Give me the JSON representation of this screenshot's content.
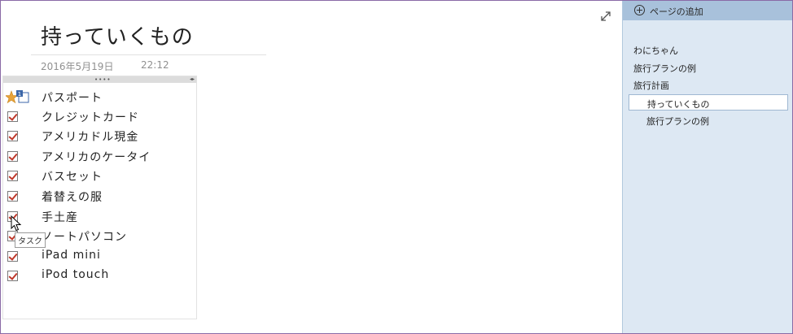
{
  "page": {
    "title": "持っていくもの",
    "date": "2016年5月19日",
    "time": "22:12"
  },
  "note": {
    "items": [
      {
        "label": "パスポート",
        "type": "star-tag"
      },
      {
        "label": "クレジットカード",
        "type": "checked"
      },
      {
        "label": "アメリカドル現金",
        "type": "checked"
      },
      {
        "label": "アメリカのケータイ",
        "type": "checked"
      },
      {
        "label": "バスセット",
        "type": "checked"
      },
      {
        "label": "着替えの服",
        "type": "checked"
      },
      {
        "label": "手土産",
        "type": "checked"
      },
      {
        "label": "ノートパソコン",
        "type": "checked"
      },
      {
        "label": "iPad mini",
        "type": "checked"
      },
      {
        "label": "iPod touch",
        "type": "checked"
      }
    ],
    "tooltip": "タスク"
  },
  "pages_pane": {
    "add_page_label": "ページの追加",
    "pages": [
      {
        "label": "わにちゃん",
        "level": 1
      },
      {
        "label": "旅行プランの例",
        "level": 1
      },
      {
        "label": "旅行計画",
        "level": 1
      },
      {
        "label": "持っていくもの",
        "level": 2,
        "selected": true
      },
      {
        "label": "旅行プランの例",
        "level": 2
      }
    ]
  },
  "colors": {
    "pane_bg": "#dde8f3",
    "add_page_bg": "#a8c1db",
    "checkmark": "#c0392b",
    "star": "#e8a33a"
  }
}
